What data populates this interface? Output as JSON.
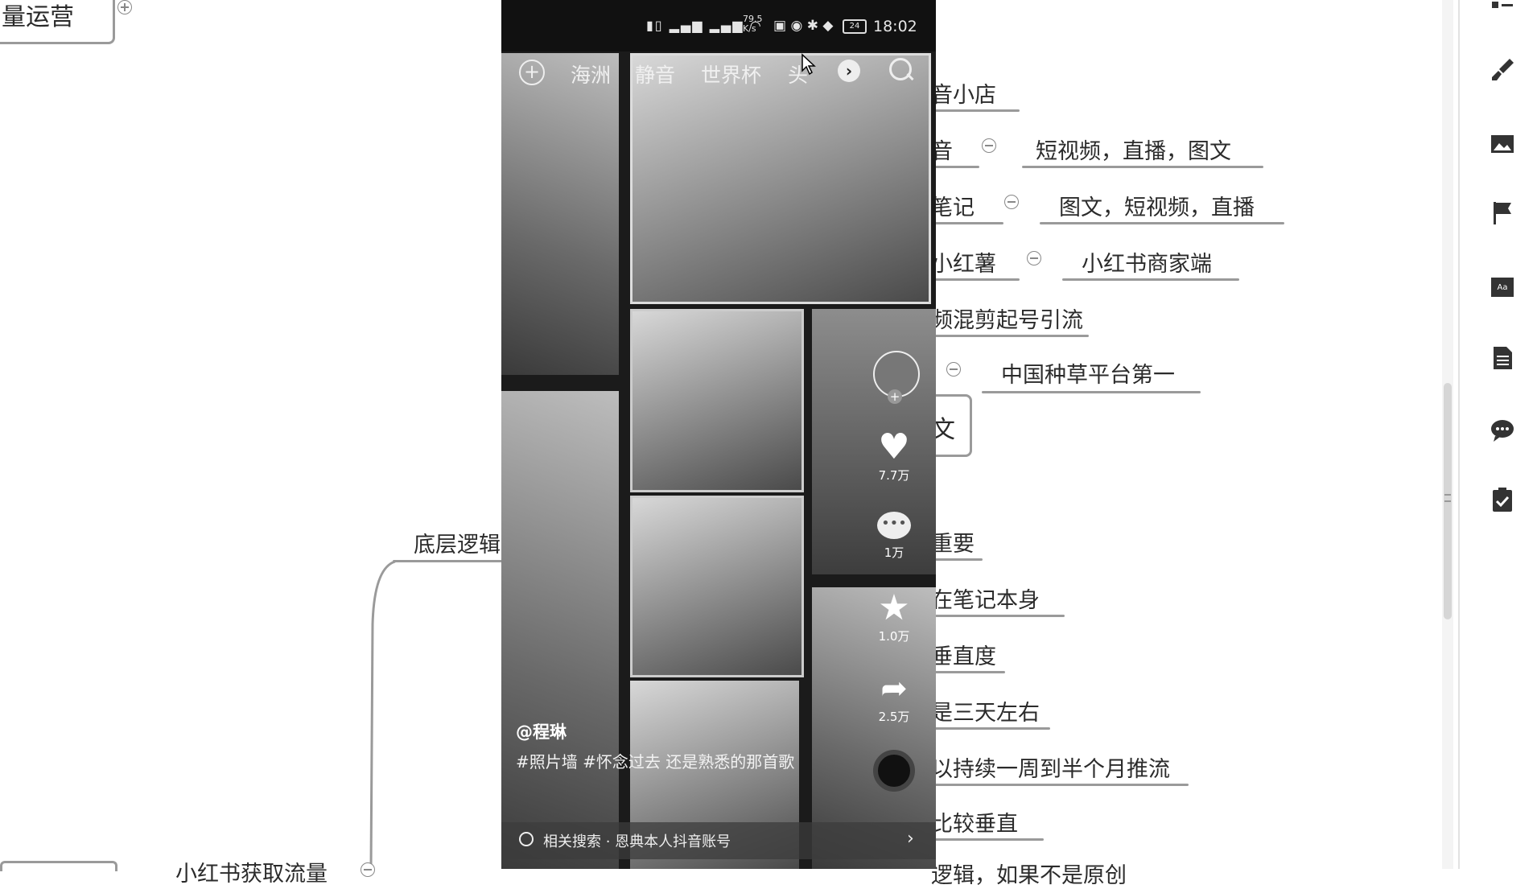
{
  "mindmap": {
    "top_left_title": "量运营",
    "items": [
      {
        "text": "音小店"
      },
      {
        "text": "音",
        "child": "短视频，直播，图文"
      },
      {
        "text": "笔记",
        "child": "图文，短视频，直播"
      },
      {
        "text": "小红薯",
        "child": "小红书商家端"
      },
      {
        "text": "频混剪起号引流"
      },
      {
        "text": "",
        "child": "中国种草平台第一"
      },
      {
        "text": "文"
      },
      {
        "text": "重要"
      },
      {
        "text": "在笔记本身"
      },
      {
        "text": "垂直度"
      },
      {
        "text": "是三天左右"
      },
      {
        "text": "以持续一周到半个月推流"
      },
      {
        "text": "比较垂直"
      },
      {
        "text": "逻辑，如果不是原创"
      }
    ],
    "branch_label": "底层逻辑",
    "bottom_label": "小红书获取流量"
  },
  "phone": {
    "status": {
      "speed": "79.5 K/s",
      "battery": "24",
      "time": "18:02"
    },
    "tabs": [
      "海洲",
      "静音",
      "世界杯",
      "头"
    ],
    "right_actions": {
      "likes": "7.7万",
      "comments": "1万",
      "favorites": "1.0万",
      "shares": "2.5万"
    },
    "author": "@程琳",
    "caption": "#照片墙 #怀念过去 还是熟悉的那首歌",
    "search_bar": "相关搜索 · 恩典本人抖音账号"
  },
  "colors": {
    "line": "#9a9a9a",
    "phone_bg": "#1b1b1b",
    "sidebar_icon": "#333333"
  }
}
